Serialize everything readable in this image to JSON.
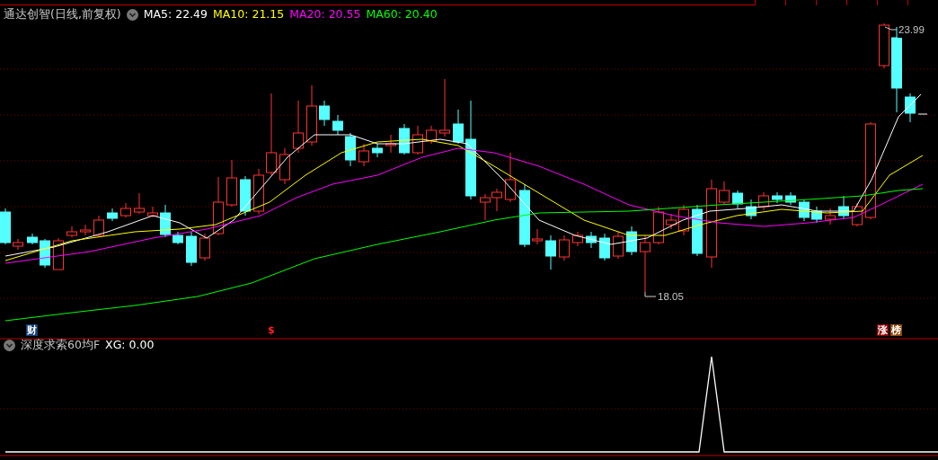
{
  "main_panel": {
    "title": "通达创智(日线,前复权)",
    "indicators": [
      {
        "label": "MA5: 22.49",
        "color": "#ffffff"
      },
      {
        "label": "MA10: 21.15",
        "color": "#ffff00"
      },
      {
        "label": "MA20: 20.55",
        "color": "#ff00ff"
      },
      {
        "label": "MA60: 20.40",
        "color": "#00ff00"
      }
    ],
    "high_label": "23.99",
    "low_label": "18.05",
    "markers": [
      {
        "text": "财",
        "kind": "finance"
      },
      {
        "text": "$",
        "kind": "dollar"
      },
      {
        "text": "涨",
        "kind": "rise"
      },
      {
        "text": "榜",
        "kind": "rank"
      }
    ]
  },
  "sub_panel": {
    "title": "深度求索60均F",
    "indicators": [
      {
        "label": "XG: 0.00",
        "color": "#ffffff"
      }
    ]
  }
}
